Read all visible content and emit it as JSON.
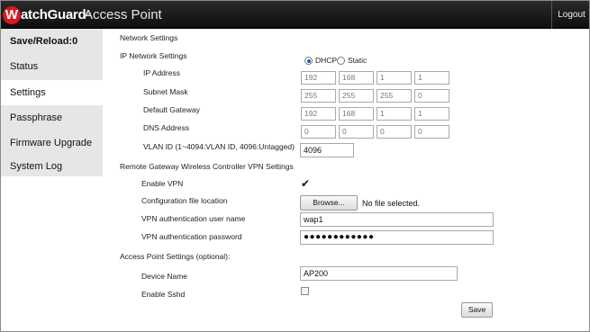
{
  "header": {
    "logo_mark": "W",
    "logo_text": "atchGuard",
    "logo_reg": "®",
    "title": "Access Point",
    "logout_label": "Logout"
  },
  "sidebar": {
    "items": [
      {
        "label": "Save/Reload:0"
      },
      {
        "label": "Status"
      },
      {
        "label": "Settings"
      },
      {
        "label": "Passphrase"
      },
      {
        "label": "Firmware Upgrade"
      },
      {
        "label": "System Log"
      }
    ],
    "active": "Settings"
  },
  "network": {
    "section_title": "Network Settings",
    "ip_title": "IP Network Settings",
    "mode_options": [
      "DHCP",
      "Static"
    ],
    "mode_selected": "DHCP",
    "ip_address_label": "IP Address",
    "ip_address": [
      "192",
      "168",
      "1",
      "1"
    ],
    "subnet_label": "Subnet Mask",
    "subnet": [
      "255",
      "255",
      "255",
      "0"
    ],
    "gateway_label": "Default Gateway",
    "gateway": [
      "192",
      "168",
      "1",
      "1"
    ],
    "dns_label": "DNS Address",
    "dns": [
      "0",
      "0",
      "0",
      "0"
    ],
    "vlan_label": "VLAN ID (1~4094:VLAN ID, 4096:Untagged)",
    "vlan_value": "4096"
  },
  "vpn": {
    "section_title": "Remote Gateway Wireless Controller VPN Settings",
    "enable_label": "Enable VPN",
    "enable_checked": true,
    "config_label": "Configuration file location",
    "browse_label": "Browse...",
    "no_file_text": "No file selected.",
    "user_label": "VPN authentication user name",
    "user_value": "wap1",
    "password_label": "VPN authentication password",
    "password_value": "●●●●●●●●●●●●"
  },
  "ap": {
    "section_title": "Access Point Settings (optional):",
    "device_name_label": "Device Name",
    "device_name_value": "AP200",
    "sshd_label": "Enable Sshd",
    "sshd_checked": false
  },
  "save_label": "Save",
  "colors": {
    "header_bg": "#141414",
    "sidebar_bg": "#e6e6e6",
    "brand_red": "#d71920"
  }
}
